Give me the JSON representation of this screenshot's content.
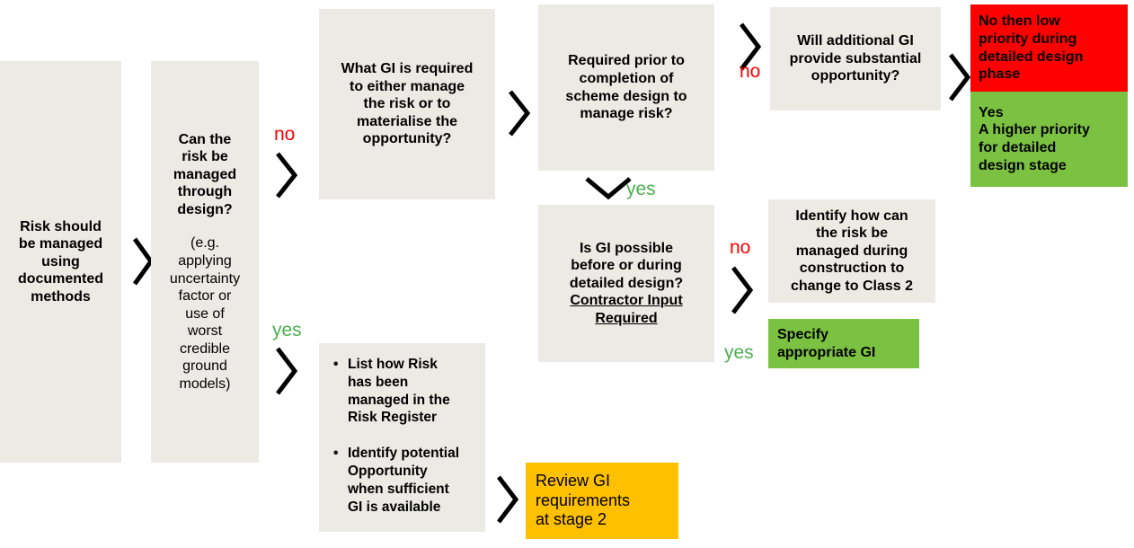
{
  "diagram": {
    "title": "Geotechnical risk / GI decision flowchart",
    "colors": {
      "box_grey": "#EBEAE5",
      "red": "#FF0000",
      "green": "#7CC242",
      "orange": "#FFC000",
      "label_no": "#FF0000",
      "label_yes": "#4CAF50",
      "text": "#000000"
    },
    "nodes": {
      "start": {
        "lines": [
          "Risk should",
          "be managed",
          "using",
          "documented",
          "methods"
        ],
        "style": "grey"
      },
      "can_risk_be_managed": {
        "question_lines": [
          "Can the",
          "risk be",
          "managed",
          "through",
          "design?"
        ],
        "note_lines": [
          "(e.g.",
          "applying",
          "uncertainty",
          "factor or",
          "use of",
          "worst",
          "credible",
          "ground",
          "models)"
        ],
        "style": "grey"
      },
      "what_gi_required": {
        "lines": [
          "What GI is required",
          "to either manage",
          "the risk or to",
          "materialise the",
          "opportunity?"
        ],
        "style": "grey"
      },
      "required_prior": {
        "lines": [
          "Required prior to",
          "completion of",
          "scheme design to",
          "manage risk?"
        ],
        "style": "grey"
      },
      "will_additional_gi": {
        "lines": [
          "Will additional GI",
          "provide substantial",
          "opportunity?"
        ],
        "style": "grey"
      },
      "no_then_low_priority": {
        "lines": [
          "No then low",
          "priority during",
          "detailed design",
          "phase"
        ],
        "style": "red"
      },
      "yes_higher_priority": {
        "lines": [
          "Yes",
          "A higher priority",
          "for detailed",
          "design stage"
        ],
        "style": "green"
      },
      "is_gi_possible": {
        "lines": [
          "Is GI possible",
          "before or during",
          "detailed design?"
        ],
        "underlined_lines": [
          "Contractor Input",
          "Required"
        ],
        "style": "grey"
      },
      "identify_how_can": {
        "lines": [
          "Identify how can",
          "the risk be",
          "managed during",
          "construction to",
          "change to Class 2"
        ],
        "style": "grey"
      },
      "specify_appropriate_gi": {
        "lines": [
          "Specify",
          "appropriate GI"
        ],
        "style": "green"
      },
      "risk_register_actions": {
        "bullets": [
          [
            "List how Risk",
            "has been",
            "managed in the",
            "Risk Register"
          ],
          [
            "Identify potential",
            "Opportunity",
            "when sufficient",
            "GI is available"
          ]
        ],
        "style": "grey"
      },
      "review_gi_stage2": {
        "lines": [
          "Review GI",
          "requirements",
          "at stage 2"
        ],
        "style": "orange"
      }
    },
    "edge_labels": {
      "no_1": "no",
      "no_2": "no",
      "no_3": "no",
      "yes_1": "yes",
      "yes_2": "yes",
      "yes_3": "yes"
    }
  }
}
